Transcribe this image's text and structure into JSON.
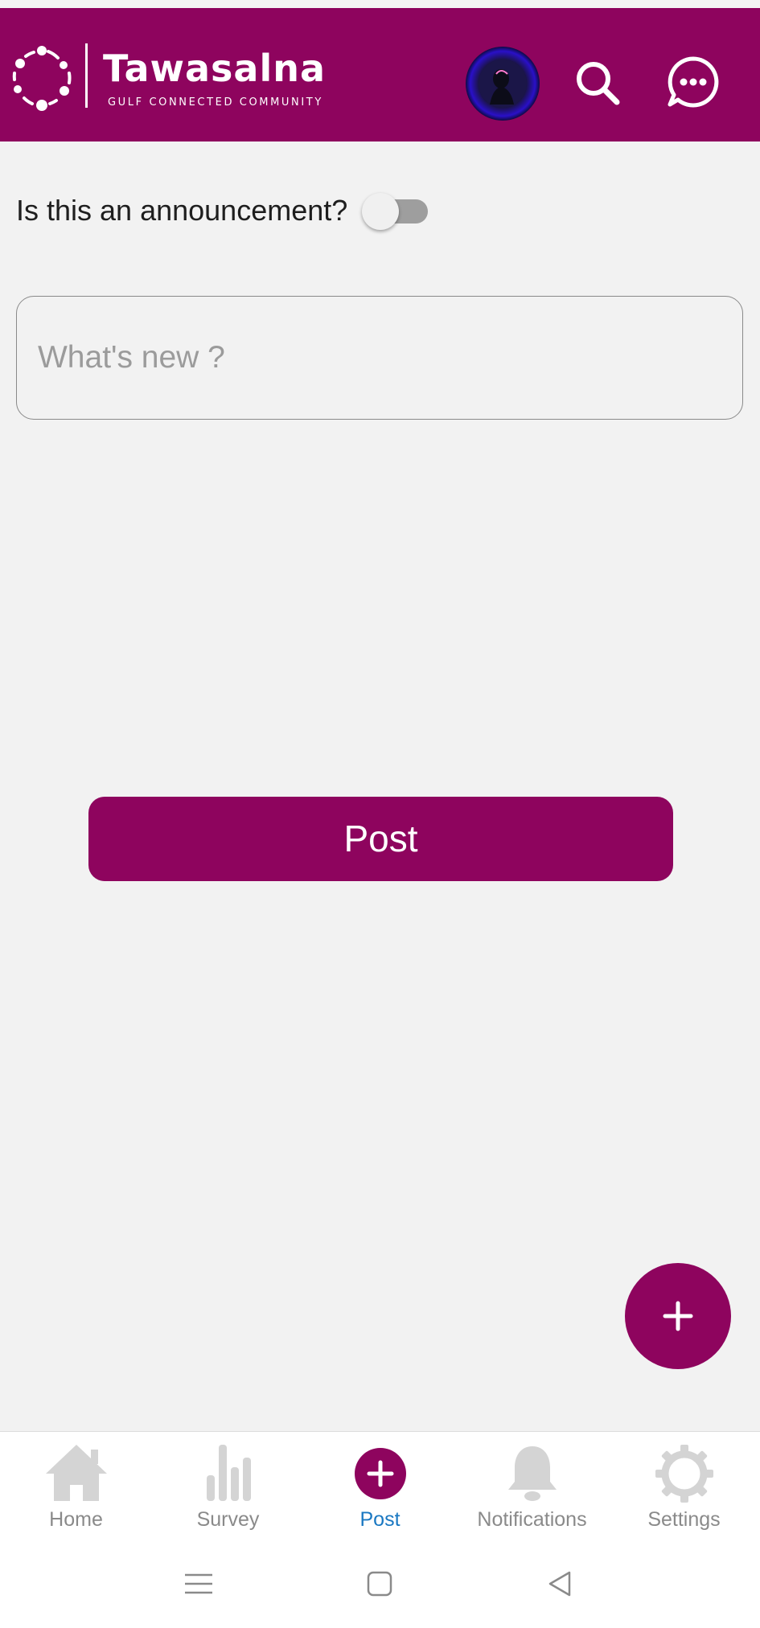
{
  "header": {
    "app_name": "Tawasalna",
    "tagline": "Gulf Connected Community",
    "brand_color": "#8e045e",
    "avatar_icon": "profile-avatar",
    "search_icon": "search-icon",
    "chat_icon": "chat-bubble-icon"
  },
  "composer": {
    "announcement_label": "Is this an announcement?",
    "announcement_toggle": false,
    "text_value": "",
    "text_placeholder": "What's new ?",
    "post_label": "Post"
  },
  "fab": {
    "icon": "plus-icon"
  },
  "bottom_nav": {
    "active_color": "#1a78c2",
    "inactive_color": "#8a8a8a",
    "items": [
      {
        "label": "Home",
        "icon": "home-icon",
        "active": false
      },
      {
        "label": "Survey",
        "icon": "bar-chart-icon",
        "active": false
      },
      {
        "label": "Post",
        "icon": "add-circle-icon",
        "active": true
      },
      {
        "label": "Notifications",
        "icon": "bell-icon",
        "active": false
      },
      {
        "label": "Settings",
        "icon": "gear-icon",
        "active": false
      }
    ]
  },
  "system_nav": {
    "buttons": [
      "menu-icon",
      "home-square-icon",
      "back-icon"
    ]
  }
}
